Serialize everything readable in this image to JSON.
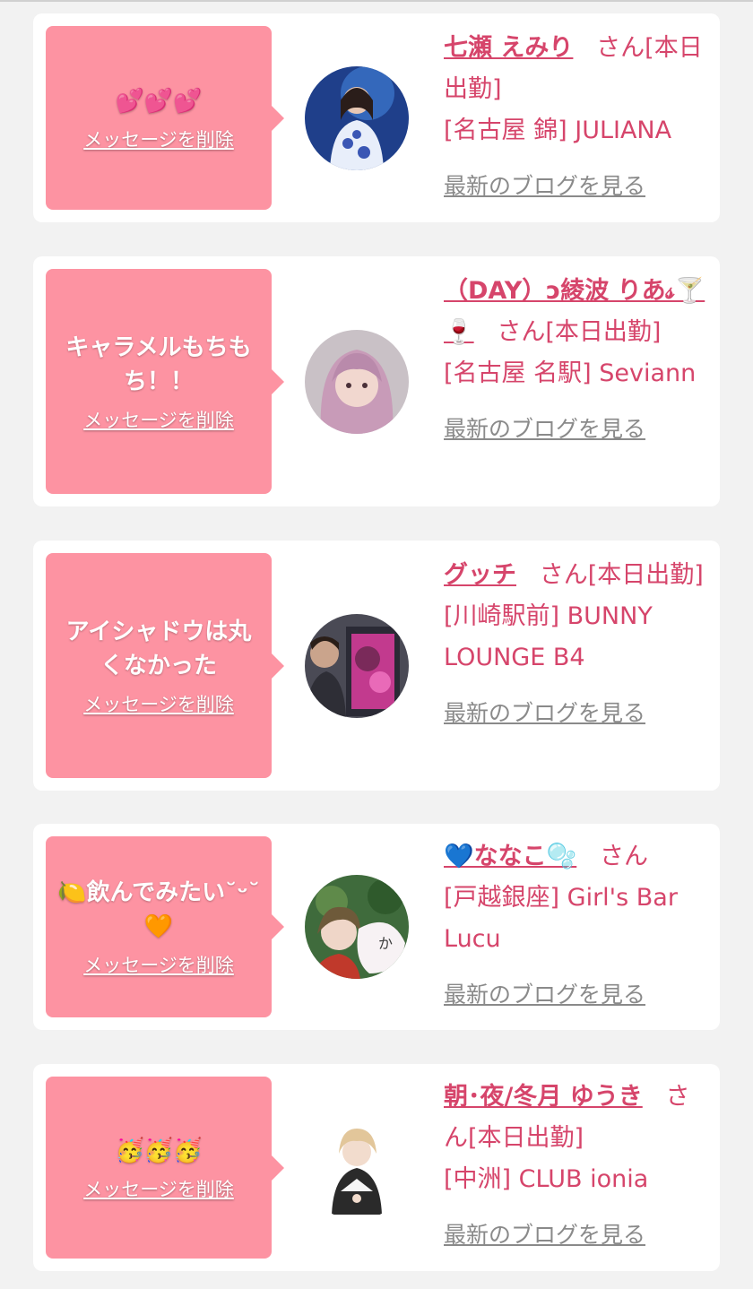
{
  "colors": {
    "background": "#f2f2f2",
    "card": "#ffffff",
    "bubble": "#fd93a2",
    "accent_text": "#d6456b",
    "link_gray": "#8a8a8a"
  },
  "delete_label": "メッセージを削除",
  "blog_label": "最新のブログを見る",
  "messages": [
    {
      "text": "💕💕💕",
      "cast_name": "七瀬 えみり",
      "suffix": "さん[本日出勤]",
      "shop": "[名古屋 錦] JULIANA",
      "avatar_icon": "avatar-photo"
    },
    {
      "text": "キャラメルもちもち！！",
      "cast_name": "（DAY）ↄ綾波 りあ𝓈🍸🍷",
      "suffix": "さん[本日出勤]",
      "shop": "[名古屋 名駅] Seviann",
      "avatar_icon": "avatar-photo"
    },
    {
      "text": "アイシャドウは丸くなかった",
      "cast_name": "グッチ",
      "suffix": "さん[本日出勤]",
      "shop": "[川崎駅前] BUNNY LOUNGE B4",
      "avatar_icon": "avatar-photo"
    },
    {
      "text": "🍋飲んでみたい˘ᵕ˘🧡",
      "cast_name": "💙ななこ🫧",
      "suffix": "さん",
      "shop": "[戸越銀座] Girl's Bar Lucu",
      "avatar_icon": "avatar-photo"
    },
    {
      "text": "🥳🥳🥳",
      "cast_name": "朝･夜/冬月 ゆうき",
      "suffix": "さん[本日出勤]",
      "shop": "[中洲] CLUB ionia",
      "avatar_icon": "avatar-photo"
    }
  ]
}
